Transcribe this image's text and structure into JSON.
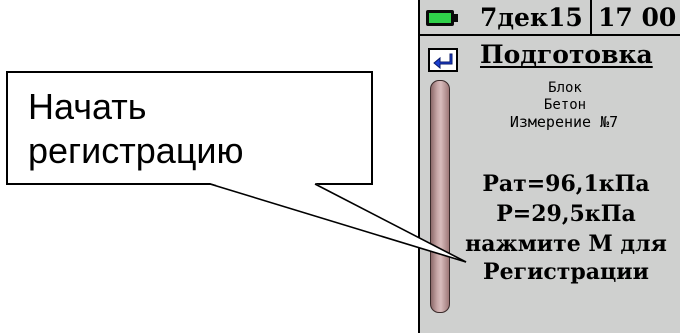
{
  "callout": {
    "line1": "Начать",
    "line2": "регистрацию"
  },
  "status": {
    "battery_icon": "battery-icon",
    "date": "7дек15",
    "time": "17 00"
  },
  "header": {
    "back_icon": "back-arrow-icon",
    "title": "Подготовка"
  },
  "info": {
    "block": "Блок",
    "material": "Бетон",
    "measurement": "Измерение №7"
  },
  "readings": {
    "p_atm": "Рат=96,1кПа",
    "pressure": "Р=29,5кПа",
    "prompt": "нажмите М для",
    "registration": "Регистрации"
  },
  "colors": {
    "screen_bg": "#cfd0cf",
    "battery_green": "#2fd14a",
    "scrollbar": "#c8a7a7",
    "back_arrow": "#1a3fd1"
  }
}
